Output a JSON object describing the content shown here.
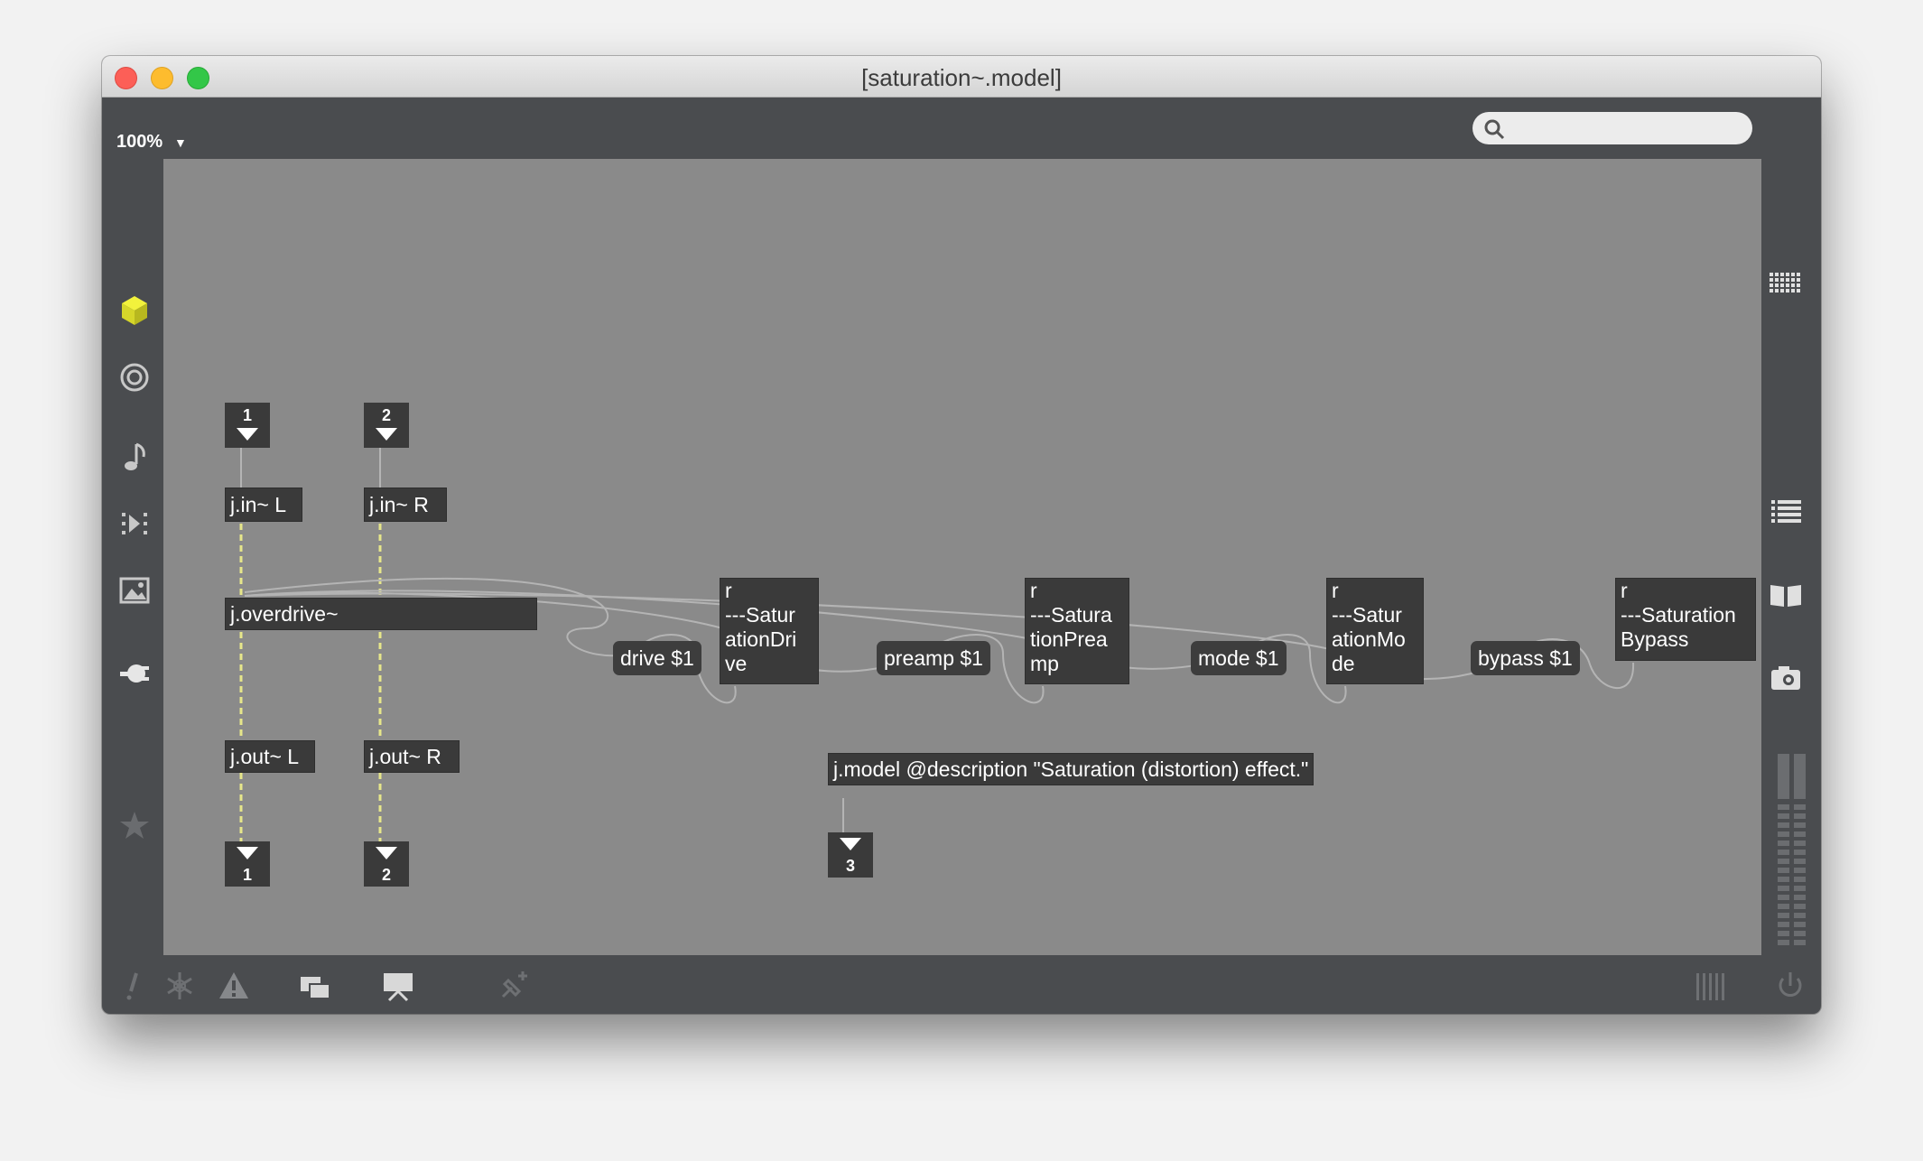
{
  "window": {
    "title": "[saturation~.model]"
  },
  "toolbar": {
    "zoom": "100%",
    "search_placeholder": ""
  },
  "left_sidebar": [
    "cube-icon",
    "target-icon",
    "music-note-icon",
    "sequence-icon",
    "image-icon",
    "plug-icon",
    "star-icon"
  ],
  "right_sidebar": [
    "grid-icon",
    "list-icon",
    "book-icon",
    "camera-icon",
    "level-meter"
  ],
  "bottom_bar": [
    "exclamation-icon",
    "snowflake-icon",
    "warning-icon",
    "windows-icon",
    "presentation-icon",
    "pin-add-icon",
    "bars-icon",
    "power-icon"
  ],
  "patch": {
    "inlet_1": "1",
    "inlet_2": "2",
    "in_l": "j.in~ L",
    "in_r": "j.in~ R",
    "overdrive": "j.overdrive~",
    "out_l": "j.out~ L",
    "out_r": "j.out~ R",
    "outlet_1": "1",
    "outlet_2": "2",
    "msg_drive": "drive $1",
    "msg_preamp": "preamp $1",
    "msg_mode": "mode $1",
    "msg_bypass": "bypass $1",
    "recv_drive": "r\n---Satur\nationDri\nve",
    "recv_preamp": "r\n---Satura\ntionPrea\nmp",
    "recv_mode": "r\n---Satur\nationMo\nde",
    "recv_bypass": "r\n---Saturation\nBypass",
    "model": "j.model @description \"Saturation (distortion) effect.\"",
    "outlet_3": "3"
  }
}
